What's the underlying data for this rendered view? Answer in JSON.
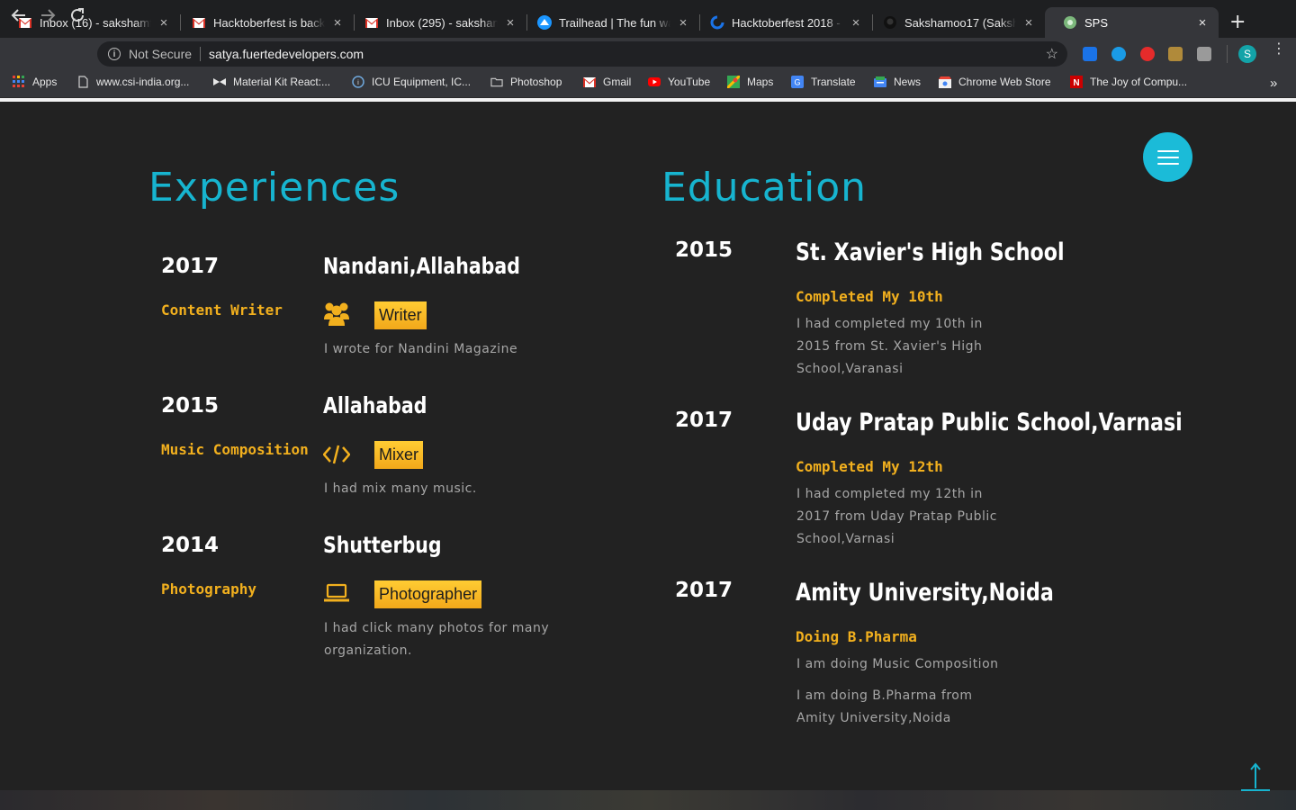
{
  "browser": {
    "tabs": [
      {
        "title": "Inbox (16) - sakshamfu",
        "icon": "gmail-icon"
      },
      {
        "title": "Hacktoberfest is back,",
        "icon": "gmail-icon"
      },
      {
        "title": "Inbox (295) - saksham",
        "icon": "gmail-icon"
      },
      {
        "title": "Trailhead | The fun wa",
        "icon": "trailhead-icon"
      },
      {
        "title": "Hacktoberfest 2018 - I",
        "icon": "hacktoberfest-icon"
      },
      {
        "title": "Sakshamoo17 (Saksha",
        "icon": "github-icon"
      },
      {
        "title": "SPS",
        "icon": "site-icon"
      }
    ],
    "close_glyph": "×",
    "new_tab_glyph": "+",
    "address": {
      "security_label": "Not Secure",
      "url": "satya.fuertedevelopers.com"
    },
    "profile_initial": "S",
    "bookmarks": [
      {
        "label": "Apps"
      },
      {
        "label": "www.csi-india.org..."
      },
      {
        "label": "Material Kit React:..."
      },
      {
        "label": "ICU Equipment, IC..."
      },
      {
        "label": "Photoshop"
      },
      {
        "label": "Gmail"
      },
      {
        "label": "YouTube"
      },
      {
        "label": "Maps"
      },
      {
        "label": "Translate"
      },
      {
        "label": "News"
      },
      {
        "label": "Chrome Web Store"
      },
      {
        "label": "The Joy of Compu..."
      }
    ],
    "overflow_glyph": "»"
  },
  "experiences": {
    "title": "Experiences",
    "items": [
      {
        "year": "2017",
        "place": "Nandani,Allahabad",
        "role": "Content Writer",
        "icon": "users-icon",
        "tag": "Writer",
        "description": "I wrote for Nandini Magazine"
      },
      {
        "year": "2015",
        "place": "Allahabad",
        "role": "Music Composition",
        "icon": "code-icon",
        "tag": "Mixer",
        "description": "I had mix many music."
      },
      {
        "year": "2014",
        "place": "Shutterbug",
        "role": "Photography",
        "icon": "laptop-icon",
        "tag": "Photographer",
        "description_lines": [
          "I had click many photos for many",
          "organization."
        ]
      }
    ]
  },
  "education": {
    "title": "Education",
    "items": [
      {
        "year": "2015",
        "school": "St. Xavier's High School",
        "status": "Completed My 10th",
        "description_lines": [
          "I had completed my 10th in",
          "2015 from St. Xavier's High",
          "School,Varanasi"
        ]
      },
      {
        "year": "2017",
        "school": "Uday Pratap Public School,Varnasi",
        "status": "Completed My 12th",
        "description_lines": [
          "I had completed my 12th in",
          "2017 from Uday Pratap Public",
          "School,Varnasi"
        ]
      },
      {
        "year": "2017",
        "school": "Amity University,Noida",
        "status": "Doing B.Pharma",
        "extra": "I am doing Music Composition",
        "description_lines": [
          "I am doing B.Pharma from",
          "Amity University,Noida"
        ]
      }
    ]
  },
  "colors": {
    "accent": "#17b4cf",
    "gold": "#f2b01e",
    "background": "#222222"
  }
}
